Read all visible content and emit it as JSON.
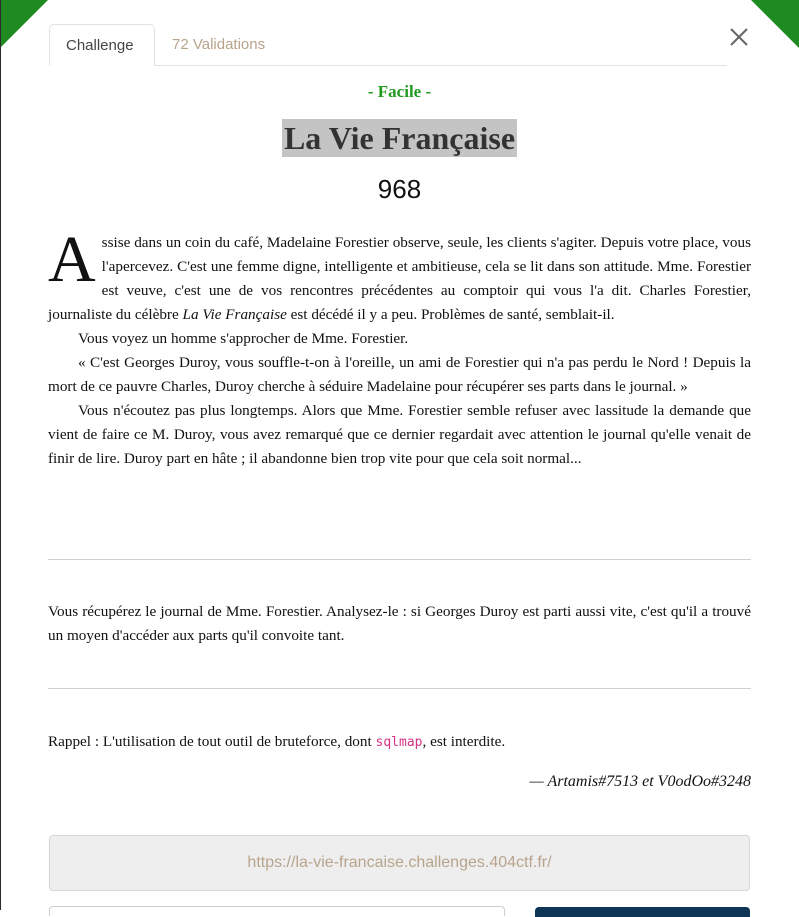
{
  "tabs": {
    "challenge": "Challenge",
    "validations": "72 Validations"
  },
  "challenge": {
    "difficulty": "- Facile -",
    "title": "La Vie Française",
    "points": "968"
  },
  "story": {
    "dropcap": "A",
    "p1_part1": "ssise dans un coin du café, Madelaine Forestier observe, seule, les clients s'agiter. Depuis votre place, vous l'apercevez. C'est une femme digne, intelligente et ambitieuse, cela se lit dans son attitude. Mme. Forestier est veuve, c'est une de vos rencontres précédentes au comptoir qui vous l'a dit. Charles Forestier, journaliste du célèbre ",
    "p1_italic": "La Vie Française",
    "p1_part2": " est décédé il y a peu. Problèmes de santé, semblait-il.",
    "p2": "Vous voyez un homme s'approcher de Mme. Forestier.",
    "p3": "« C'est Georges Duroy, vous souffle-t-on à l'oreille, un ami de Forestier qui n'a pas perdu le Nord ! Depuis la mort de ce pauvre Charles, Duroy cherche à séduire Madelaine pour récupérer ses parts dans le journal. »",
    "p4": "Vous n'écoutez pas plus longtemps. Alors que Mme. Forestier semble refuser avec lassitude la demande que vient de faire ce M. Duroy, vous avez remarqué que ce dernier regardait avec attention le journal qu'elle venait de finir de lire. Duroy part en hâte ; il abandonne bien trop vite pour que cela soit normal..."
  },
  "task": "Vous récupérez le journal de Mme. Forestier. Analysez-le : si Georges Duroy est parti aussi vite, c'est qu'il a trouvé un moyen d'accéder aux parts qu'il convoite tant.",
  "rappel": {
    "before": "Rappel : L'utilisation de tout outil de bruteforce, dont ",
    "tool": "sqlmap",
    "after": ", est interdite."
  },
  "authors": "— Artamis#7513 et V0odOo#3248",
  "url": "https://la-vie-francaise.challenges.404ctf.fr/",
  "icons": {
    "close": "close-icon"
  },
  "colors": {
    "accent_green": "#1f8a1f",
    "difficulty_green": "#1f9a1f",
    "muted_tan": "#b8a48c",
    "code_pink": "#d63384",
    "submit_navy": "#0f3557"
  }
}
